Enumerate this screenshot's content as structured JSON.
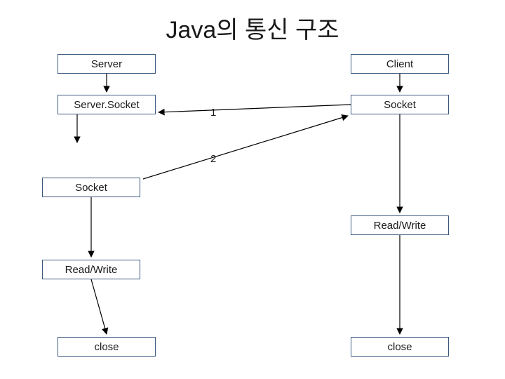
{
  "title": "Java의 통신 구조",
  "nodes": {
    "server": "Server",
    "client": "Client",
    "serverSocket": "Server.Socket",
    "socketRight": "Socket",
    "socketLeft": "Socket",
    "rwRight": "Read/Write",
    "rwLeft": "Read/Write",
    "closeLeft": "close",
    "closeRight": "close"
  },
  "labels": {
    "step1": "1",
    "step2": "2"
  }
}
